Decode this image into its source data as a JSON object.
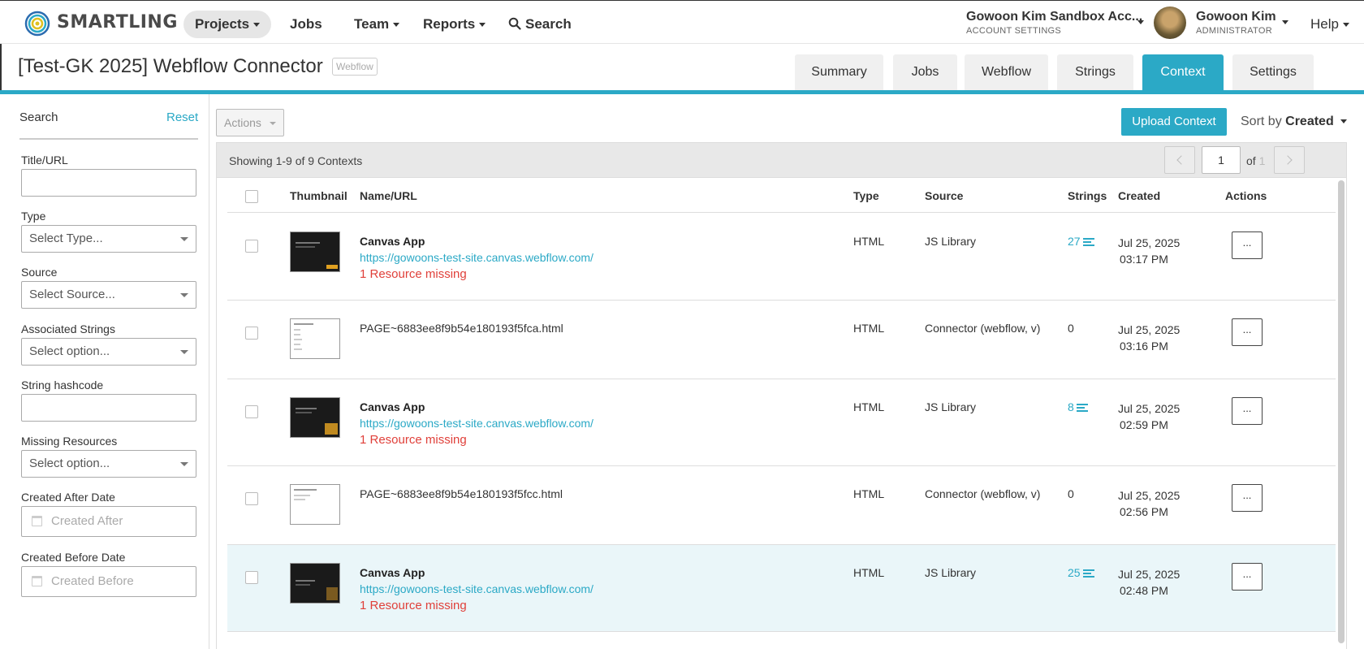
{
  "nav": {
    "brand": "SMARTLING",
    "items": [
      {
        "label": "Projects",
        "caret": true
      },
      {
        "label": "Jobs",
        "caret": false
      },
      {
        "label": "Team",
        "caret": true
      },
      {
        "label": "Reports",
        "caret": true
      },
      {
        "label": "Search",
        "caret": false
      }
    ],
    "account_name": "Gowoon Kim Sandbox Acc...",
    "account_sub": "ACCOUNT SETTINGS",
    "user_name": "Gowoon Kim",
    "user_role": "ADMINISTRATOR",
    "help": "Help"
  },
  "project": {
    "title": "[Test-GK 2025] Webflow Connector",
    "tag": "Webflow",
    "tabs": [
      "Summary",
      "Jobs",
      "Webflow",
      "Strings",
      "Context",
      "Settings"
    ],
    "active_tab": "Context"
  },
  "sidebar": {
    "search_label": "Search",
    "reset_label": "Reset",
    "filters": {
      "title_url": {
        "label": "Title/URL",
        "value": ""
      },
      "type": {
        "label": "Type",
        "placeholder": "Select Type..."
      },
      "source": {
        "label": "Source",
        "placeholder": "Select Source..."
      },
      "associated_strings": {
        "label": "Associated Strings",
        "placeholder": "Select option..."
      },
      "string_hashcode": {
        "label": "String hashcode",
        "value": ""
      },
      "missing_resources": {
        "label": "Missing Resources",
        "placeholder": "Select option..."
      },
      "created_after": {
        "label": "Created After Date",
        "placeholder": "Created After"
      },
      "created_before": {
        "label": "Created Before Date",
        "placeholder": "Created Before"
      }
    }
  },
  "toolbar": {
    "actions_label": "Actions",
    "upload_label": "Upload Context",
    "sort_prefix": "Sort by",
    "sort_value": "Created"
  },
  "listing": {
    "showing": "Showing 1-9 of 9 Contexts",
    "page": "1",
    "of_label": "of",
    "total_pages": "1"
  },
  "table": {
    "headers": [
      "Thumbnail",
      "Name/URL",
      "Type",
      "Source",
      "Strings",
      "Created",
      "Actions"
    ],
    "rows": [
      {
        "title": "Canvas App",
        "url": "https://gowoons-test-site.canvas.webflow.com/",
        "missing": "1 Resource missing",
        "type": "HTML",
        "source": "JS Library",
        "strings": "27",
        "strings_link": true,
        "date": "Jul 25, 2025",
        "time": "03:17 PM",
        "thumb": "dark",
        "action": "..."
      },
      {
        "title": "",
        "url": "",
        "missing": "",
        "file": "PAGE~6883ee8f9b54e180193f5fca.html",
        "type": "HTML",
        "source": "Connector (webflow, v)",
        "strings": "0",
        "strings_link": false,
        "date": "Jul 25, 2025",
        "time": "03:16 PM",
        "thumb": "light",
        "action": "..."
      },
      {
        "title": "Canvas App",
        "url": "https://gowoons-test-site.canvas.webflow.com/",
        "missing": "1 Resource missing",
        "type": "HTML",
        "source": "JS Library",
        "strings": "8",
        "strings_link": true,
        "date": "Jul 25, 2025",
        "time": "02:59 PM",
        "thumb": "dark",
        "action": "..."
      },
      {
        "title": "",
        "url": "",
        "missing": "",
        "file": "PAGE~6883ee8f9b54e180193f5fcc.html",
        "type": "HTML",
        "source": "Connector (webflow, v)",
        "strings": "0",
        "strings_link": false,
        "date": "Jul 25, 2025",
        "time": "02:56 PM",
        "thumb": "light",
        "action": "..."
      },
      {
        "title": "Canvas App",
        "url": "https://gowoons-test-site.canvas.webflow.com/",
        "missing": "1 Resource missing",
        "type": "HTML",
        "source": "JS Library",
        "strings": "25",
        "strings_link": true,
        "date": "Jul 25, 2025",
        "time": "02:48 PM",
        "thumb": "dark",
        "action": "...",
        "highlight": true
      }
    ]
  },
  "colors": {
    "accent": "#2ba9c6",
    "error": "#e0403a",
    "highlight_row": "#eaf6f9"
  }
}
